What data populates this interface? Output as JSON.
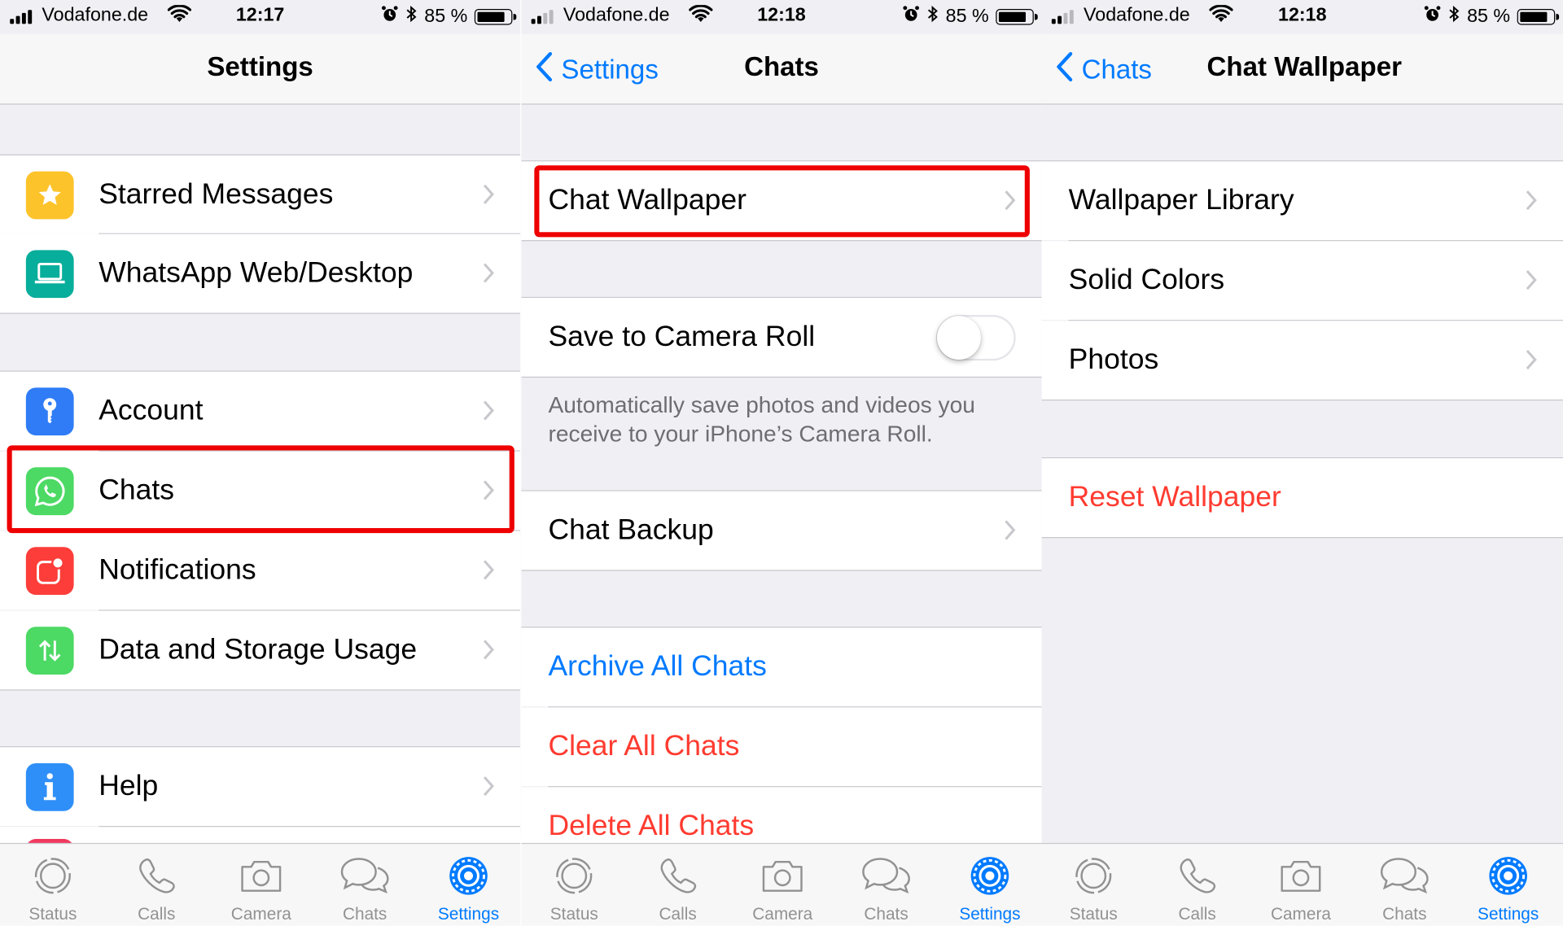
{
  "status_bars": [
    {
      "carrier": "Vodafone.de",
      "time": "12:17",
      "battery": "85 %",
      "battery_level": 0.85
    },
    {
      "carrier": "Vodafone.de",
      "time": "12:18",
      "battery": "85 %",
      "battery_level": 0.85
    },
    {
      "carrier": "Vodafone.de",
      "time": "12:18",
      "battery": "85 %",
      "battery_level": 0.85
    }
  ],
  "settings_screen": {
    "title": "Settings",
    "rows": {
      "starred": "Starred Messages",
      "web": "WhatsApp Web/Desktop",
      "account": "Account",
      "chats": "Chats",
      "notifications": "Notifications",
      "data": "Data and Storage Usage",
      "help": "Help"
    }
  },
  "chats_screen": {
    "back": "Settings",
    "title": "Chats",
    "chat_wallpaper": "Chat Wallpaper",
    "save_to_camera_roll": "Save to Camera Roll",
    "save_to_camera_roll_on": false,
    "footnote": "Automatically save photos and videos you receive to your iPhone’s Camera Roll.",
    "chat_backup": "Chat Backup",
    "archive_all": "Archive All Chats",
    "clear_all": "Clear All Chats",
    "delete_all": "Delete All Chats"
  },
  "wallpaper_screen": {
    "back": "Chats",
    "title": "Chat Wallpaper",
    "library": "Wallpaper Library",
    "solid": "Solid Colors",
    "photos": "Photos",
    "reset": "Reset Wallpaper"
  },
  "tabbar": {
    "status": "Status",
    "calls": "Calls",
    "camera": "Camera",
    "chats": "Chats",
    "settings": "Settings",
    "active": "Settings"
  },
  "colors": {
    "accent": "#007aff",
    "destructive": "#ff3b30",
    "highlight": "#ee0000",
    "whatsapp_green": "#4cd964"
  }
}
